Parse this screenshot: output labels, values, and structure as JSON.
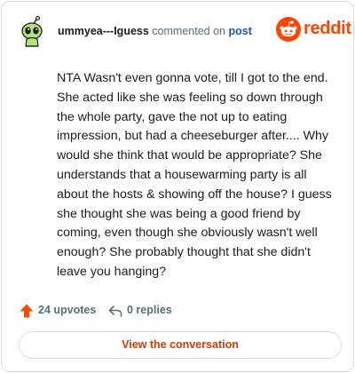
{
  "header": {
    "username": "ummyea---Iguess",
    "action_text": "commented on",
    "post_link": "post",
    "brand_name": "reddit",
    "avatar_icon": "alien-avatar-icon",
    "brand_icon": "reddit-snoo-icon"
  },
  "comment": {
    "text": "NTA Wasn't even gonna vote, till I got to the end. She acted like she was feeling so down through the whole party, gave the not up to eating impression, but had a cheeseburger after.... Why would she think that would be appropriate? She understands that a housewarming party is all about the hosts & showing off the house? I guess she thought she was being a good friend by coming, even though she obviously wasn't well enough? She probably thought that she didn't leave you hanging?"
  },
  "stats": {
    "upvotes_label": "24 upvotes",
    "replies_label": "0 replies",
    "upvote_icon": "upvote-arrow-icon",
    "reply_icon": "reply-arrow-icon"
  },
  "cta": {
    "label": "View the conversation"
  },
  "colors": {
    "brand": "#ff4500",
    "cta_text": "#d93a00",
    "link": "#1e55a8",
    "muted": "#576f76",
    "border": "#d9dde0"
  }
}
